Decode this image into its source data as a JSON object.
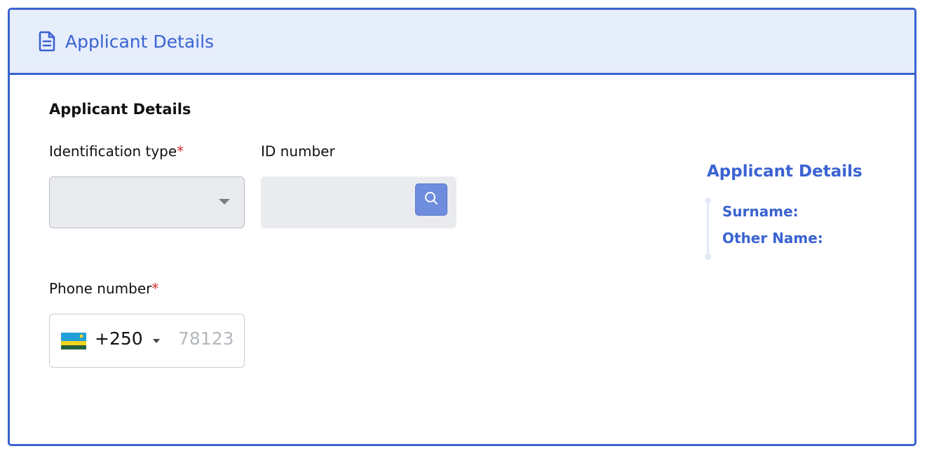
{
  "card": {
    "header_title": "Applicant Details",
    "header_icon": "document-icon"
  },
  "form": {
    "section_title": "Applicant Details",
    "identification_type": {
      "label": "Identification type",
      "required_marker": "*",
      "value": ""
    },
    "id_number": {
      "label": "ID number",
      "value": "",
      "search_icon": "search-icon"
    },
    "phone_number": {
      "label": "Phone number",
      "required_marker": "*",
      "country_flag": "rwanda-flag-icon",
      "dial_code": "+250",
      "placeholder": "78123"
    }
  },
  "side_panel": {
    "title": "Applicant Details",
    "surname_label": "Surname:",
    "other_name_label": "Other Name:"
  },
  "colors": {
    "accent": "#3a63d1",
    "header_background": "#e6edfb",
    "required": "#d32f2f",
    "search_button": "#6f8ddd"
  }
}
